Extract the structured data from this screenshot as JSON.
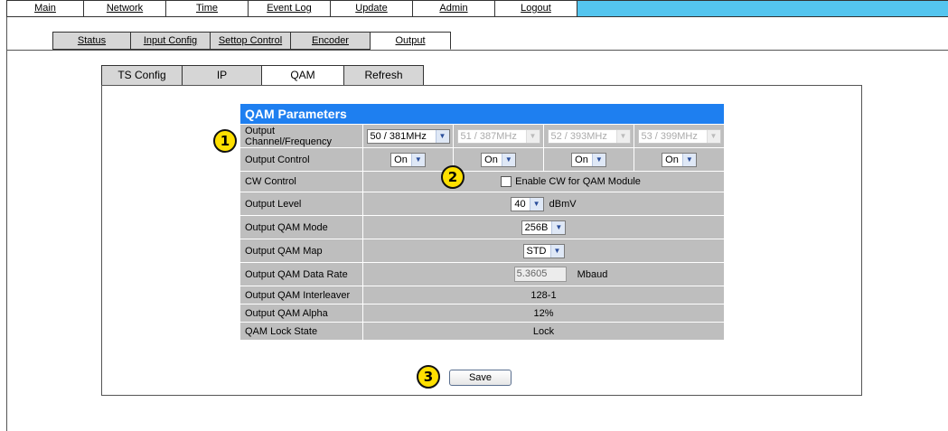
{
  "top_nav": [
    "Main",
    "Network",
    "Time",
    "Event Log",
    "Update",
    "Admin",
    "Logout"
  ],
  "sub_nav": [
    "Status",
    "Input Config",
    "Settop Control",
    "Encoder",
    "Output"
  ],
  "sub_nav_active": "Output",
  "tabs": [
    "TS Config",
    "IP",
    "QAM",
    "Refresh"
  ],
  "tabs_active": "QAM",
  "qam": {
    "title": "QAM Parameters",
    "rows": {
      "channel_label": "Output Channel/Frequency",
      "channels": [
        "50 / 381MHz",
        "51 / 387MHz",
        "52 / 393MHz",
        "53 / 399MHz"
      ],
      "control_label": "Output Control",
      "controls": [
        "On",
        "On",
        "On",
        "On"
      ],
      "cw_label": "CW Control",
      "cw_text": "Enable CW for QAM Module",
      "level_label": "Output Level",
      "level_value": "40",
      "level_unit": "dBmV",
      "mode_label": "Output QAM Mode",
      "mode_value": "256B",
      "map_label": "Output QAM Map",
      "map_value": "STD",
      "rate_label": "Output QAM Data Rate",
      "rate_value": "5.3605",
      "rate_unit": "Mbaud",
      "interleaver_label": "Output QAM Interleaver",
      "interleaver_value": "128-1",
      "alpha_label": "Output QAM Alpha",
      "alpha_value": "12%",
      "lock_label": "QAM Lock State",
      "lock_value": "Lock"
    }
  },
  "save_label": "Save",
  "markers": [
    "1",
    "2",
    "3"
  ],
  "colors": {
    "header_blue": "#1e7ff0",
    "nav_fill": "#54c5ef",
    "marker": "#ffe000"
  }
}
